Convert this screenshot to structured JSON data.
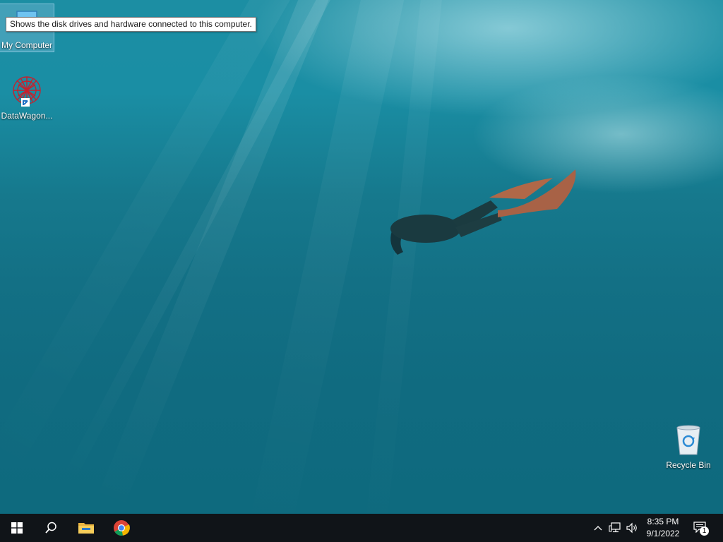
{
  "desktop": {
    "wallpaper": "underwater-freediver",
    "icons": [
      {
        "label": "My Computer",
        "icon": "computer-icon"
      },
      {
        "label": "DataWagon...",
        "icon": "datawagon-icon"
      },
      {
        "label": "Recycle Bin",
        "icon": "recycle-bin-icon"
      }
    ],
    "tooltip": "Shows the disk drives and hardware connected to this computer."
  },
  "taskbar": {
    "start": "windows-start-icon",
    "search": "search-icon",
    "pinned": [
      "file-explorer-icon",
      "chrome-icon"
    ],
    "tray": {
      "show_hidden": "chevron-up-icon",
      "network": "network-icon",
      "volume": "volume-icon",
      "time": "8:35 PM",
      "date": "9/1/2022",
      "notifications_count": "1"
    }
  },
  "colors": {
    "taskbar": "#101418",
    "water_top": "#1c8ea3",
    "water_bottom": "#0e6a7e"
  }
}
